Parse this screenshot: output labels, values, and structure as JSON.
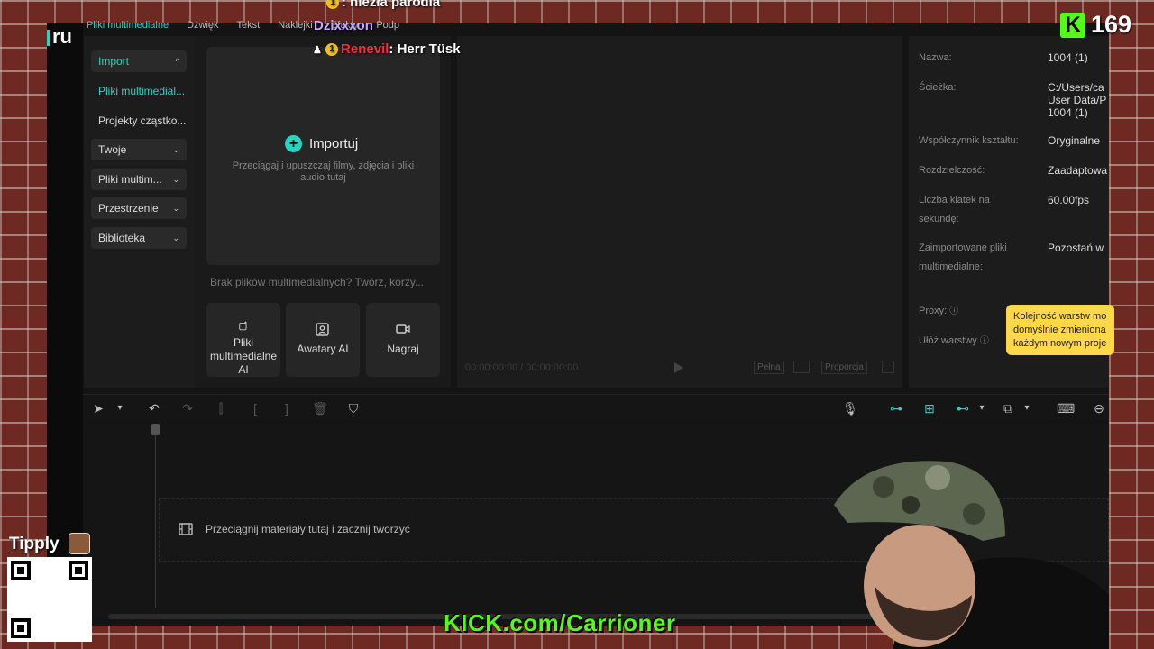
{
  "app": {
    "brand": "ru",
    "top_tabs": [
      "Pliki multimedialne",
      "Dźwięk",
      "Tekst",
      "Naklejki",
      "Efekty",
      "Podp"
    ]
  },
  "sidebar": {
    "import": "Import",
    "media_files": "Pliki multimedial...",
    "particle_projects": "Projekty cząstko...",
    "yours": "Twoje",
    "multimedia": "Pliki multim...",
    "spaces": "Przestrzenie",
    "library": "Biblioteka"
  },
  "media": {
    "import_label": "Importuj",
    "drop_hint": "Przeciągaj i upuszczaj filmy, zdjęcia i pliki audio tutaj",
    "empty_hint": "Brak plików multimedialnych? Twórz, korzy...",
    "tile_media": "Pliki multimedialne AI",
    "tile_avatars": "Awatary AI",
    "tile_record": "Nagraj"
  },
  "preview": {
    "timecode": "00:00:00:00 / 00:00:00:00",
    "full_label": "Pełna",
    "ratio_label": "Proporcja"
  },
  "properties": {
    "name_label": "Nazwa:",
    "name_value": "1004 (1)",
    "path_label": "Ścieżka:",
    "path_value_1": "C:/Users/ca",
    "path_value_2": "User Data/P",
    "path_value_3": "1004 (1)",
    "aspect_label": "Współczynnik kształtu:",
    "aspect_value": "Oryginalne",
    "resolution_label": "Rozdzielczość:",
    "resolution_value": "Zaadaptowa",
    "fps_label": "Liczba klatek na sekundę:",
    "fps_value": "60.00fps",
    "imported_label": "Zaimportowane pliki multimedialne:",
    "imported_value": "Pozostań w",
    "proxy_label": "Proxy:",
    "layers_label": "Ułóż warstwy",
    "tooltip": "Kolejność warstw mo domyślnie zmieniona każdym nowym proje"
  },
  "timeline": {
    "drop_hint": "Przeciągnij materiały tutaj i zacznij tworzyć"
  },
  "overlay": {
    "chat_top_text": ": niezła parodia",
    "chat_user_1": "Dzixxxon",
    "chat_user_2": "Renevil",
    "chat_msg_2": ": Herr Tüsk",
    "badge": "1",
    "kick_viewers": "169",
    "tipply": "Tipply",
    "kick_url": "KICK.com/Carrioner"
  },
  "colors": {
    "accent": "#2bd3c3",
    "tooltip_bg": "#ffd84a",
    "kick_green": "#53fc18",
    "chat_red": "#ff2a3d"
  }
}
